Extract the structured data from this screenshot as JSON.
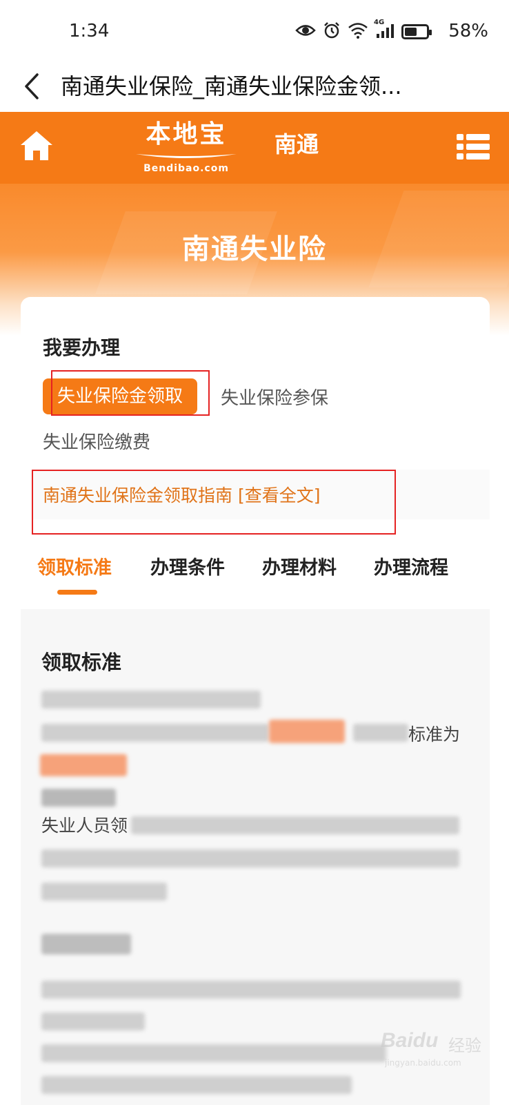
{
  "status_bar": {
    "time": "1:34",
    "network": "4G",
    "battery_percent": "58%",
    "battery_level": 0.58
  },
  "header": {
    "back_icon": "chevron-left-icon",
    "title": "南通失业保险_南通失业保险金领..."
  },
  "site_nav": {
    "logo_text": "本地宝",
    "logo_sub": "Bendibao.com",
    "city": "南通",
    "home_icon": "home-icon",
    "menu_icon": "menu-icon"
  },
  "banner": {
    "title": "南通失业险"
  },
  "handle": {
    "heading": "我要办理",
    "options": [
      {
        "label": "失业保险金领取",
        "active": true
      },
      {
        "label": "失业保险参保",
        "active": false
      },
      {
        "label": "失业保险缴费",
        "active": false
      }
    ],
    "guide_link": "南通失业保险金领取指南 [查看全文]"
  },
  "tabs": [
    {
      "label": "领取标准",
      "active": true
    },
    {
      "label": "办理条件",
      "active": false
    },
    {
      "label": "办理材料",
      "active": false
    },
    {
      "label": "办理流程",
      "active": false
    }
  ],
  "content": {
    "heading": "领取标准",
    "visible_fragments": {
      "standard_suffix": "标准为",
      "unemployed_prefix": "失业人员领"
    }
  },
  "watermark": {
    "brand": "Baidu",
    "cn": "经验",
    "url": "jingyan.baidu.com"
  },
  "colors": {
    "accent": "#f57a16",
    "highlight_box": "#e52222"
  }
}
